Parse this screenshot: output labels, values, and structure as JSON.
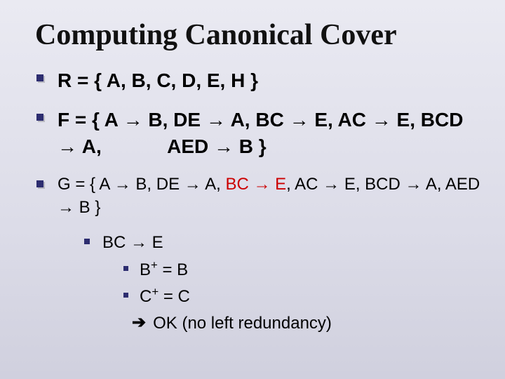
{
  "title": "Computing Canonical Cover",
  "items": {
    "r": "R = { A, B, C, D, E, H }",
    "f_part1": "F = { A → B, DE → A, BC → E, AC → E, BCD → A,",
    "f_part2_indent": "AED → B }",
    "g_part1": "G = { A → B, DE → A, ",
    "g_red": "BC → E",
    "g_part2": ", AC → E, BCD → A, AED → B }",
    "sub1": "BC → E",
    "sub2a": "B",
    "sub2b": " = B",
    "sub3a": "C",
    "sub3b": " = C",
    "conclusion": " OK (no left redundancy)",
    "arrow_glyph": "➔",
    "plus": "+"
  }
}
